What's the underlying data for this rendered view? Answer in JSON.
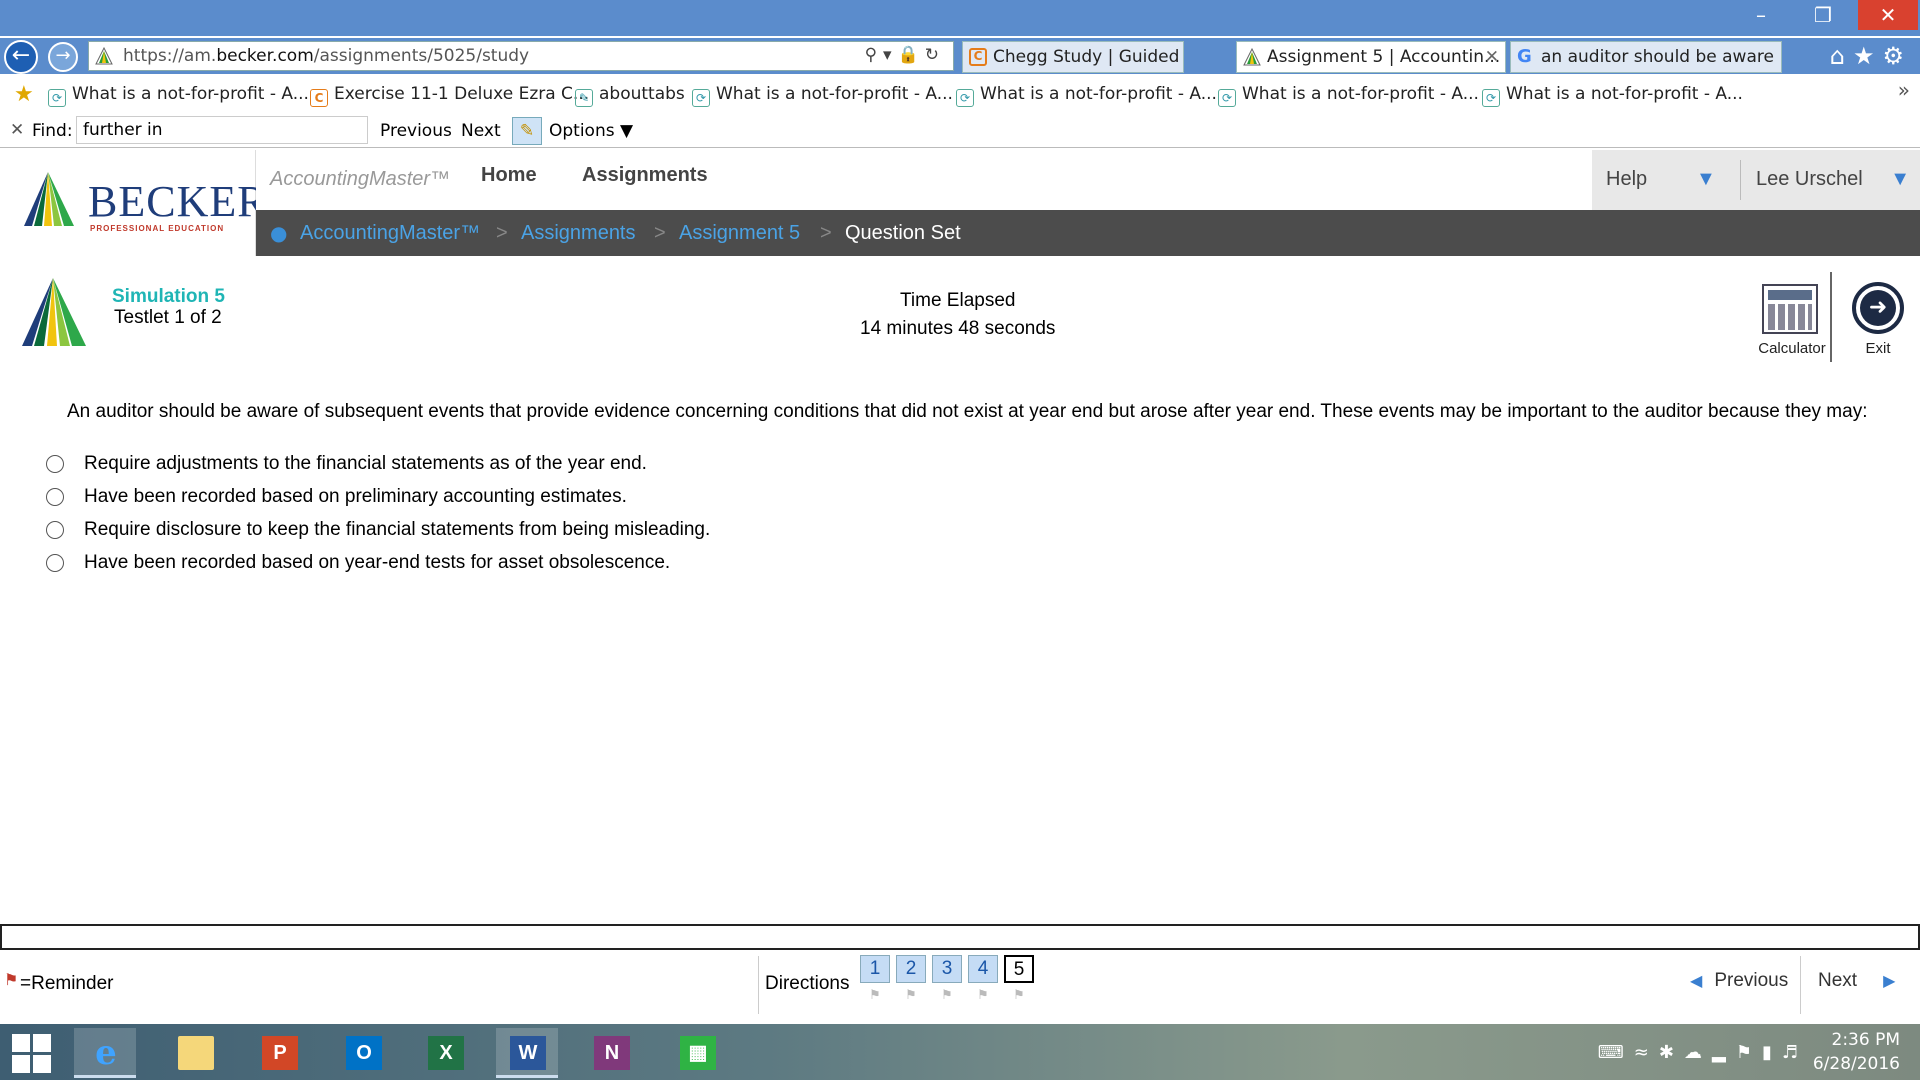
{
  "browser": {
    "url_prefix": "https://am.",
    "url_domain": "becker.com",
    "url_path": "/assignments/5025/study",
    "tabs": [
      {
        "title": "Chegg Study | Guided Soluti...",
        "active": false
      },
      {
        "title": "Assignment 5 | Accountin...",
        "active": true
      },
      {
        "title": "an auditor should be aware ...",
        "active": false
      }
    ],
    "favorites": [
      "What is a not-for-profit - A...",
      "Exercise 11-1 Deluxe Ezra C...",
      "abouttabs",
      "What is a not-for-profit - A...",
      "What is a not-for-profit - A...",
      "What is a not-for-profit - A...",
      "What is a not-for-profit - A..."
    ],
    "find": {
      "label": "Find:",
      "value": "further in",
      "previous": "Previous",
      "next": "Next",
      "options": "Options"
    }
  },
  "header": {
    "logo_text": "BECKER",
    "logo_subtitle": "PROFESSIONAL EDUCATION",
    "brand": "AccountingMaster™",
    "nav_home": "Home",
    "nav_assignments": "Assignments",
    "help": "Help",
    "user": "Lee Urschel"
  },
  "breadcrumb": {
    "items": [
      "AccountingMaster™",
      "Assignments",
      "Assignment 5"
    ],
    "current": "Question Set"
  },
  "simulation": {
    "title": "Simulation 5",
    "testlet": "Testlet 1 of 2",
    "time_label": "Time Elapsed",
    "time_value": "14 minutes 48 seconds",
    "calculator": "Calculator",
    "exit": "Exit"
  },
  "question": {
    "text": "An auditor should be aware of subsequent events that provide evidence concerning conditions that did not exist at year end but arose after year end. These events may be important to the auditor because they may:",
    "options": [
      "Require adjustments to the financial statements as of the year end.",
      "Have been recorded based on preliminary accounting estimates.",
      "Require disclosure to keep the financial statements from being misleading.",
      "Have been recorded based on year-end tests for asset obsolescence."
    ]
  },
  "footer": {
    "reminder": "=Reminder",
    "directions": "Directions",
    "questions": [
      "1",
      "2",
      "3",
      "4",
      "5"
    ],
    "current_question": "5",
    "previous": "Previous",
    "next": "Next"
  },
  "taskbar": {
    "time": "2:36 PM",
    "date": "6/28/2016"
  },
  "colors": {
    "accent_blue": "#4aa3e6",
    "teal_title": "#1fb5b5",
    "breadcrumb_bg": "#4c4c4c",
    "titlebar": "#5b8ccc"
  }
}
